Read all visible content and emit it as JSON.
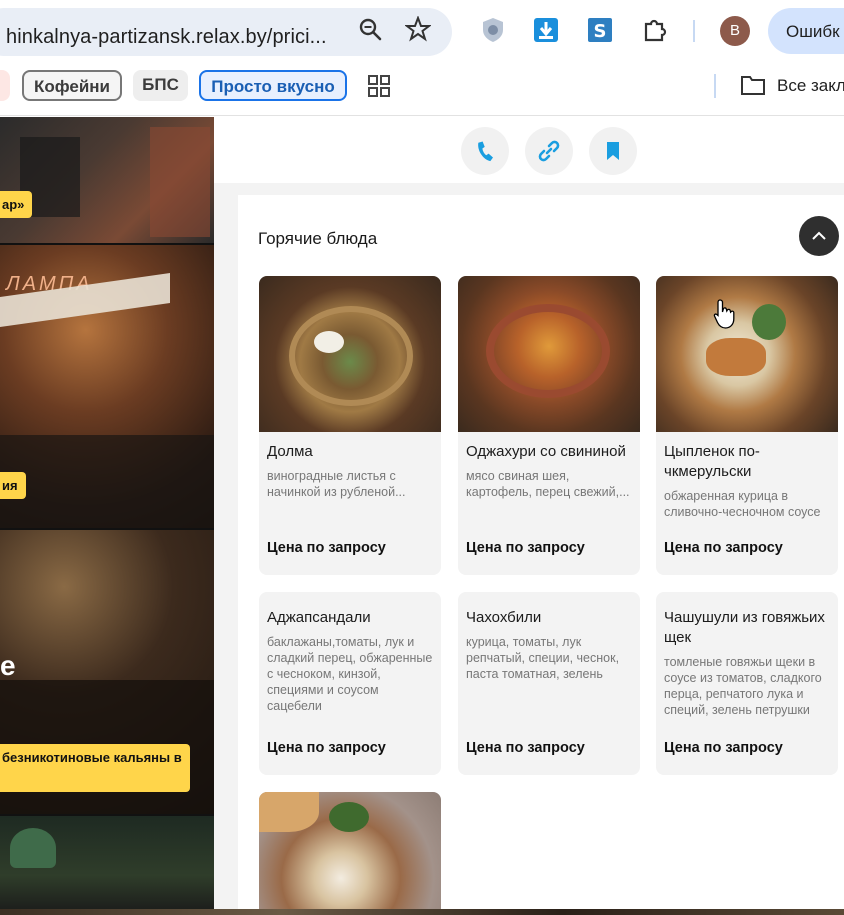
{
  "browser": {
    "url": "hinkalnya-partizansk.relax.by/prici...",
    "avatar_letter": "В",
    "error_button": "Ошибк"
  },
  "bookmarks": {
    "items": [
      "Кофейни",
      "БПС",
      "Просто вкусно"
    ],
    "all_bookmarks": "Все закл"
  },
  "venues": {
    "badge1": "ар»",
    "neon_sign": "ЛАМПА",
    "badge2": "ия",
    "big_letter": "е",
    "badge3": "безникотиновые кальяны в"
  },
  "menu": {
    "section_title": "Горячие блюда",
    "dishes": [
      {
        "name": "Долма",
        "desc": "виноградные листья с начинкой из рубленой...",
        "price": "Цена по запросу"
      },
      {
        "name": "Оджахури со свининой",
        "desc": "мясо свиная шея, картофель, перец свежий,...",
        "price": "Цена по запросу"
      },
      {
        "name": "Цыпленок по-чкмерульски",
        "desc": "обжаренная курица в сливочно-чесночном соусе",
        "price": "Цена по запросу"
      },
      {
        "name": "Аджапсандали",
        "desc": "баклажаны,томаты, лук и сладкий перец, обжаренные с чесноком, кинзой, специями и соусом сацебели",
        "price": "Цена по запросу"
      },
      {
        "name": "Чахохбили",
        "desc": "курица, томаты, лук репчатый, специи, чеснок, паста томатная, зелень",
        "price": "Цена по запросу"
      },
      {
        "name": "Чашушули из говяжьих щек",
        "desc": "томленые говяжьи щеки в соусе из томатов, сладкого перца, репчатого лука и специй, зелень петрушки",
        "price": "Цена по запросу"
      },
      {
        "name": "",
        "desc": "",
        "price": ""
      }
    ]
  },
  "colors": {
    "accent_blue": "#1a9ee0",
    "badge_yellow": "#ffd54a",
    "chip_active": "#1a73e8"
  }
}
